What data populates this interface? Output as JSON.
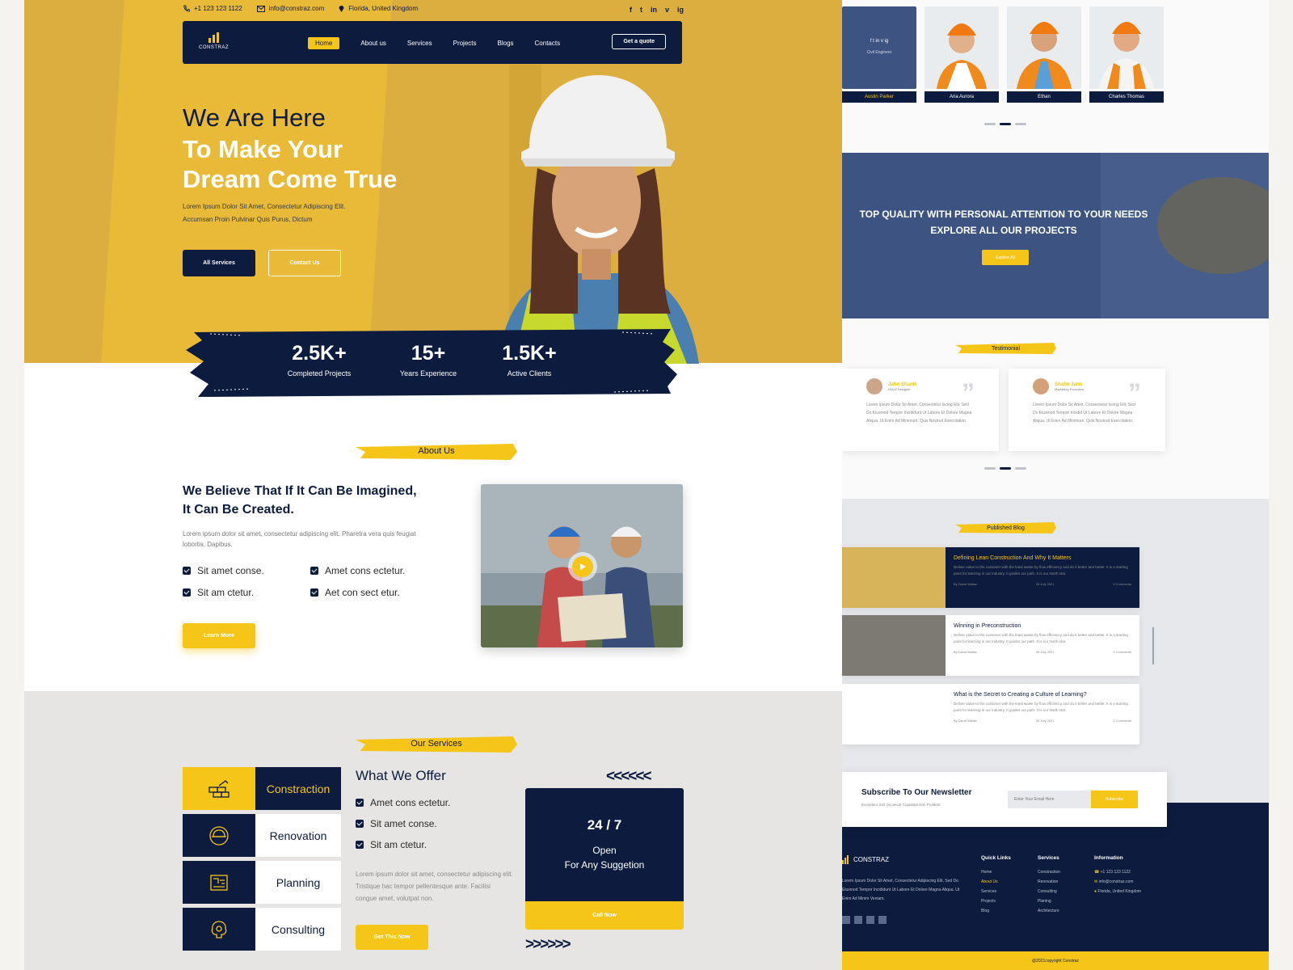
{
  "topbar": {
    "phone": "+1 123 123 1122",
    "email": "info@constraz.com",
    "location": "Florida, United Kingdom"
  },
  "social": [
    "f",
    "t",
    "in",
    "v",
    "ig"
  ],
  "brand": "CONSTRAZ",
  "nav": {
    "items": [
      "Home",
      "About us",
      "Services",
      "Projects",
      "Blogs",
      "Contacts"
    ],
    "cta": "Get a quote"
  },
  "hero": {
    "line1": "We Are Here",
    "line2": "To Make Your",
    "line3": "Dream Come True",
    "sub1": "Lorem Ipsum Dolor Sit Amet, Consectetur Adipiscing Elit.",
    "sub2": "Accumsan Proin Pulvinar Quis Purus, Dictum",
    "btn_primary": "All Services",
    "btn_secondary": "Contact Us"
  },
  "stats": [
    {
      "value": "2.5K+",
      "label": "Completed Projects"
    },
    {
      "value": "15+",
      "label": "Years Experience"
    },
    {
      "value": "1.5K+",
      "label": "Active Clients"
    }
  ],
  "about": {
    "tag": "About Us",
    "title": "We Believe That If It Can Be Imagined, It Can Be Created.",
    "text": "Lorem ipsum dolor sit amet, consectetur adipiscing elit. Pharetra vera quis feugiat lobortis. Dapibus.",
    "checks": [
      "Sit amet conse.",
      "Amet cons ectetur.",
      "Sit am ctetur.",
      "Aet con sect etur."
    ],
    "btn": "Learn More"
  },
  "services": {
    "tag": "Our Services",
    "items": [
      "Constraction",
      "Renovation",
      "Planning",
      "Consulting"
    ],
    "offer_title": "What We Offer",
    "offer_checks": [
      "Amet cons ectetur.",
      "Sit amet conse.",
      "Sit am ctetur."
    ],
    "offer_text": "Lorem ipsum dolor sit amet, consectetur adipiscing elit. Tristique hac tempor pellentesque ante. Facilisi congue amet, volutpat non.",
    "btn": "Get This Now",
    "card_title": "24 / 7",
    "card_line1": "Open",
    "card_line2": "For Any Suggetion",
    "card_btn": "Call Now",
    "arrows_left": "<<<<<<",
    "arrows_right": ">>>>>>"
  },
  "team": [
    {
      "name": "Austin Parker",
      "role": "Civil Engineer"
    },
    {
      "name": "Aria Aurora"
    },
    {
      "name": "Ethan"
    },
    {
      "name": "Charles Thomas"
    }
  ],
  "banner": {
    "line1": "TOP QUALITY WITH PERSONAL ATTENTION TO YOUR NEEDS",
    "line2": "EXPLORE ALL OUR PROJECTS",
    "btn": "Explore All"
  },
  "testimonial": {
    "tag": "Testimonial",
    "items": [
      {
        "name": "Jafut Shanik",
        "role": "UI/UX Designer",
        "text": "Lorem Ipsum Dolor Sit Amet, Consectetur Iscing Elit, Sed Do Eiusmod Tempor Incididunt Ut Labore Et Dolore Magna Aliqua. Ut Enim Ad Minimum, Quis Nostrud Exercitation."
      },
      {
        "name": "Shafin Jarin",
        "role": "Marketing Executive",
        "text": "Lorem Ipsum Dolor Sit Amet, Consectetur Iscing Elit, Sed Do Eiusmod Tempor Incidid Ut Labore Et Dolore Magna Aliqua. Ut Enim Ad Minimum, Quis Nostrud Exercitation."
      }
    ]
  },
  "blog": {
    "tag": "Published Blog",
    "posts": [
      {
        "title": "Defining Lean Construction And Why It Matters",
        "body": "Deliver value to the customer with the least waste by flow efficiency and do it better and better. It is a starting point for learning in our industry. It guides our path. It is our North star.",
        "author": "By David Wallac",
        "date": "26 July 2021",
        "comments": "3 Comments"
      },
      {
        "title": "Winning in Preconstruction",
        "body": "Deliver value to the customer with the least waste by flow efficiency and do it better and better. It is a starting point for learning in our industry. It guides our path. It is our North star.",
        "author": "By David Wallac",
        "date": "26 July 2021",
        "comments": "3 Comments"
      },
      {
        "title": "What is the Secret to Creating a Culture of Learning?",
        "body": "Deliver value to the customer with the least waste by flow efficiency and do it better and better. It is a starting point for learning in our industry. It guides our path. It is our North star.",
        "author": "By David Wallac",
        "date": "26 July 2021",
        "comments": "3 Comments"
      }
    ]
  },
  "newsletter": {
    "title": "Subscribe To Our Newsletter",
    "sub": "Excepteur Sint Occaecat Cupidatat Non Proident",
    "placeholder": "Enter Your Email Here",
    "btn": "Subscribe"
  },
  "footer": {
    "about": "Lorem Ipsum Dolor Sit Amet, Consectetur Adipiscing Elit, Sed Do Eiusmod Tempor Incididunt Ut Labore Et Dolore Magna Aliqua. Ut Enim Ad Minim Veniam.",
    "quick_title": "Quick Links",
    "quick": [
      "Home",
      "About Us",
      "Services",
      "Projects",
      "Blog"
    ],
    "services_title": "Services",
    "services": [
      "Constraction",
      "Renovation",
      "Consulting",
      "Planing",
      "Architecture"
    ],
    "info_title": "Information",
    "phone": "+1 123 123 1122",
    "email": "info@constraz.com",
    "address": "Florida, United Kingdom",
    "copyright": "@2021copyright Constraz"
  },
  "colors": {
    "navy": "#0d1b3e",
    "yellow": "#f5c518",
    "hero_bg": "#dcae3f"
  }
}
